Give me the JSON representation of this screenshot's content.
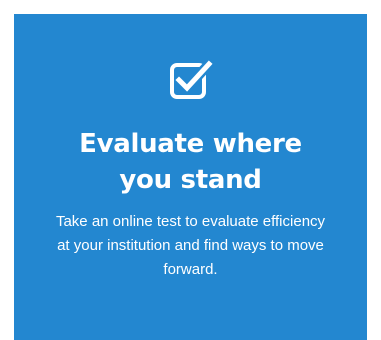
{
  "card": {
    "icon": "checkbox-checked-icon",
    "background_color": "#2387d0",
    "text_color": "#ffffff",
    "title_lines": [
      "Evaluate where",
      "you stand"
    ],
    "description_lines": [
      "Take an online test to evaluate efficiency",
      "at your institution and find ways to move",
      "forward."
    ]
  }
}
